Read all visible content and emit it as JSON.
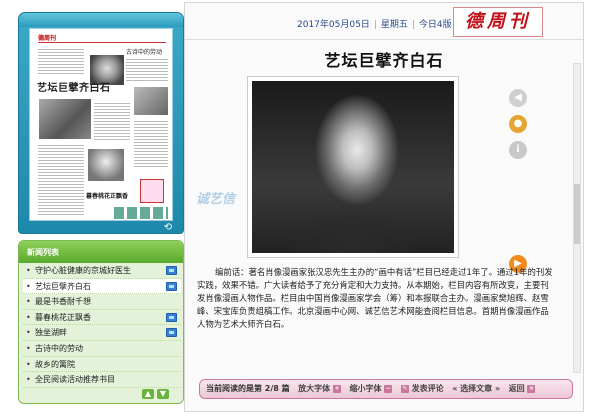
{
  "thumbnail": {
    "logo": "德周刊",
    "headline": "艺坛巨擘齐白石",
    "right_title": "古诗中的劳动",
    "mid_title": "暮春桃花正飘香"
  },
  "news_list": {
    "header": "新闻列表",
    "items": [
      {
        "label": "守护心脏健康的京城好医生",
        "has_image": true
      },
      {
        "label": "艺坛巨擘齐白石",
        "has_image": true
      },
      {
        "label": "最是书香耐千想",
        "has_image": false
      },
      {
        "label": "暮春桃花正飘香",
        "has_image": true
      },
      {
        "label": "独坐湖畔",
        "has_image": true
      },
      {
        "label": "古诗中的劳动",
        "has_image": false
      },
      {
        "label": "故乡的篱院",
        "has_image": false
      },
      {
        "label": "全民阅读活动推荐书目",
        "has_image": false
      }
    ],
    "footer": {
      "up": "▲",
      "down": "▼"
    }
  },
  "header": {
    "date": "2017年05月05日",
    "weekday": "星期五",
    "page": "今日4版",
    "brand": "德周刊"
  },
  "article": {
    "title": "艺坛巨擘齐白石",
    "body": "编前话：著名肖像漫画家张汉忠先生主办的“画中有话”栏目已经走过1年了。通过1年的刊发实践，效果不错。广大读者给予了充分肯定和大力支持。从本期始，栏目内容有所改变，主要刊发肖像漫画人物作品。栏目由中国肖像漫画家学会（筹）和本报联合主办。漫画家樊旭辉、赵雪峰、宋宝库负责组稿工作。北京漫画中心网、诚艺信艺术网能查阅栏目信息。首期肖像漫画作品人物为艺术大师齐白石。"
  },
  "bottom_bar": {
    "current": "当前阅读的是第 2/8 篇",
    "font_bigger": "放大字体",
    "font_smaller": "缩小字体",
    "comment": "发表评论",
    "choose": "选择文章",
    "back": "返回"
  },
  "watermark": "诚艺信",
  "colors": {
    "accent_blue": "#1e88aa",
    "list_green": "#58a92d",
    "brand_red": "#c0101a",
    "bottom_bar_pink": "#ecc7d6"
  }
}
